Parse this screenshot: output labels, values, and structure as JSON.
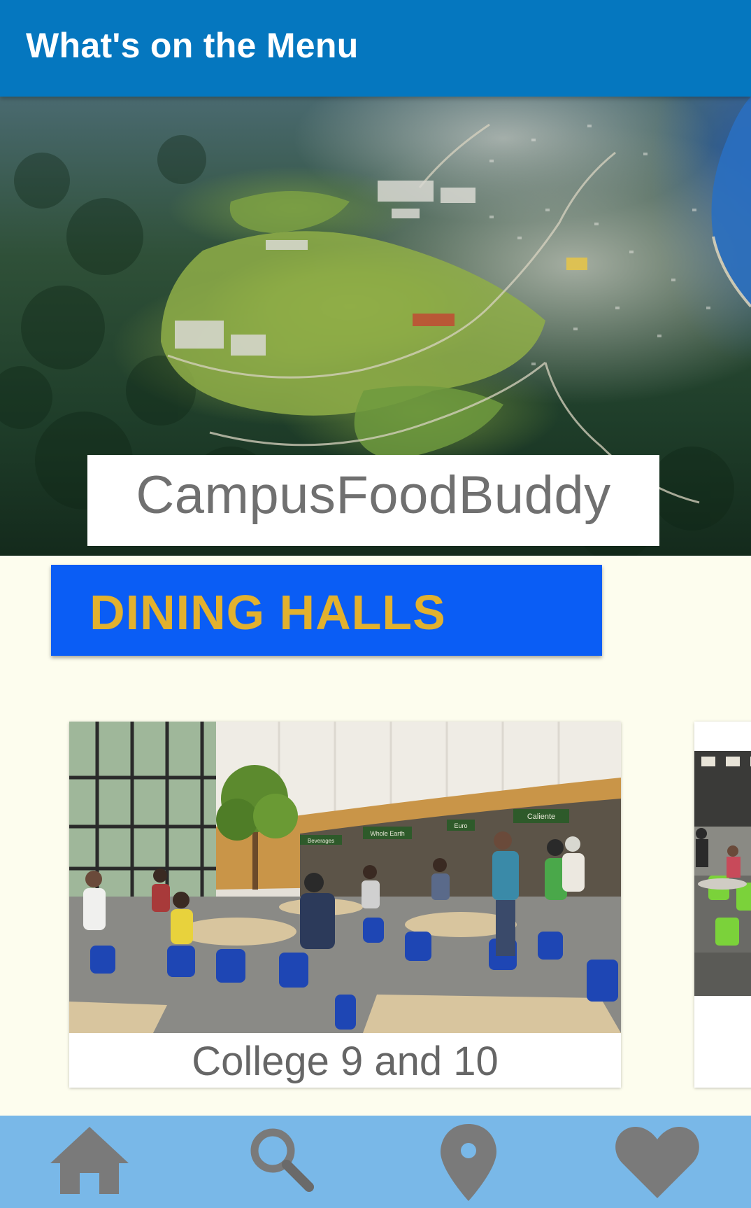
{
  "appbar": {
    "title": "What's on the Menu",
    "color": "#0577bf"
  },
  "hero": {
    "image": "aerial-campus-photo",
    "brand_name": "CampusFoodBuddy"
  },
  "dining_halls_button": {
    "label": "DINING HALLS",
    "background": "#0a5df5",
    "text_color": "#e2b12e"
  },
  "dining_cards": [
    {
      "name": "College 9 and 10",
      "image": "dining-hall-interior-photo"
    },
    {
      "name": "",
      "image": "dining-hall-interior-photo"
    }
  ],
  "bottom_nav": {
    "background": "#79b8e8",
    "items": [
      {
        "icon": "home-icon"
      },
      {
        "icon": "search-icon"
      },
      {
        "icon": "location-pin-icon"
      },
      {
        "icon": "heart-icon"
      }
    ]
  }
}
